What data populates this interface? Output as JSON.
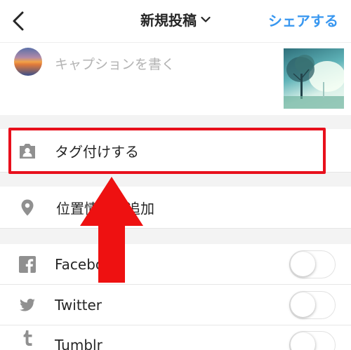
{
  "header": {
    "title": "新規投稿",
    "title_icon": "chevron-down-icon",
    "back_icon": "chevron-left-icon",
    "share_label": "シェアする"
  },
  "compose": {
    "caption_placeholder": "キャプションを書く",
    "avatar_icon": "profile-avatar",
    "thumbnail_icon": "photo-thumbnail"
  },
  "options": {
    "tag_label": "タグ付けする",
    "tag_icon": "person-tag-icon",
    "location_label": "位置情報を追加",
    "location_icon": "location-pin-icon"
  },
  "share_targets": [
    {
      "label": "Facebook",
      "icon": "facebook-icon",
      "enabled": false
    },
    {
      "label": "Twitter",
      "icon": "twitter-icon",
      "enabled": false
    },
    {
      "label": "Tumblr",
      "icon": "tumblr-icon",
      "enabled": false
    }
  ],
  "colors": {
    "accent": "#3897f0",
    "highlight": "#e8101c",
    "arrow": "#ee1111",
    "separator": "#f3f3f3",
    "placeholder": "#b3b3b3"
  }
}
